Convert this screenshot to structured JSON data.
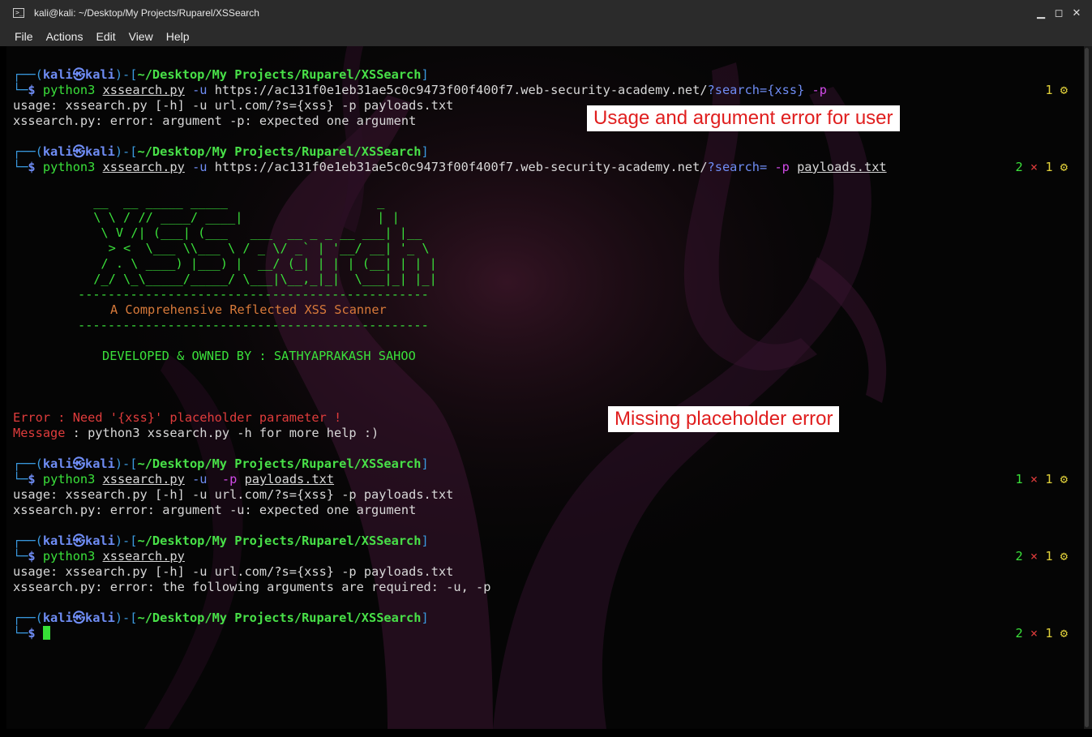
{
  "window": {
    "title": "kali@kali: ~/Desktop/My Projects/Ruparel/XSSearch",
    "controls": [
      "▁",
      "◻",
      "✕"
    ]
  },
  "menu": [
    "File",
    "Actions",
    "Edit",
    "View",
    "Help"
  ],
  "prompt": {
    "user": "kali",
    "at_symbol": "㉿",
    "host": "kali",
    "path": "~/Desktop/My Projects/Ruparel/XSSearch",
    "dollar": "$"
  },
  "cmd1": {
    "python": "python3",
    "script": "xssearch.py",
    "u_flag": "-u",
    "url": "https://ac131f0e1eb31ae5c0c9473f00f400f7.web-security-academy.net/",
    "query": "?search=",
    "placeholder": "{xss}",
    "p_flag": "-p",
    "status": "1 ⚙",
    "out1": "usage: xssearch.py [-h] -u url.com/?s={xss} -p payloads.txt",
    "out2": "xssearch.py: error: argument -p: expected one argument"
  },
  "cmd2": {
    "python": "python3",
    "script": "xssearch.py",
    "u_flag": "-u",
    "url": "https://ac131f0e1eb31ae5c0c9473f00f400f7.web-security-academy.net/",
    "query": "?search=",
    "p_flag": "-p",
    "payloads": "payloads.txt",
    "status_a": "2",
    "status_x": "×",
    "status_b": "1 ⚙"
  },
  "banner": {
    "art1": " __  __ _____ _____                    _     ",
    "art2": " \\ \\ / // ____/ ____|                  | |    ",
    "art3": "  \\ V /| (___| (___   ___  __ _ _ __ ___| |__  ",
    "art4": "   > <  \\___ \\\\___ \\ / _ \\/ _` | '__/ __| '_ \\ ",
    "art5": "  / . \\ ____) |___) |  __/ (_| | | | (__| | | |",
    "art6": " /_/ \\_\\_____/_____/ \\___|\\__,_|_|  \\___|_| |_|",
    "rule": "-----------------------------------------------",
    "tagline": "A Comprehensive Reflected XSS Scanner",
    "developer": "DEVELOPED & OWNED BY : SATHYAPRAKASH SAHOO"
  },
  "errors": {
    "error_label": "Error",
    "error_text": " : Need '{xss}' placeholder parameter !",
    "message_label": "Message",
    "message_text": " : python3 xssearch.py -h for more help :)"
  },
  "cmd3": {
    "python": "python3",
    "script": "xssearch.py",
    "u_flag": "-u",
    "p_flag": "-p",
    "payloads": "payloads.txt",
    "status_a": "1",
    "status_x": "×",
    "status_b": "1 ⚙",
    "out1": "usage: xssearch.py [-h] -u url.com/?s={xss} -p payloads.txt",
    "out2": "xssearch.py: error: argument -u: expected one argument"
  },
  "cmd4": {
    "python": "python3",
    "script": "xssearch.py",
    "status_a": "2",
    "status_x": "×",
    "status_b": "1 ⚙",
    "out1": "usage: xssearch.py [-h] -u url.com/?s={xss} -p payloads.txt",
    "out2": "xssearch.py: error: the following arguments are required: -u, -p"
  },
  "cmd5": {
    "status_a": "2",
    "status_x": "×",
    "status_b": "1 ⚙"
  },
  "annotations": {
    "usage": "Usage and argument error  for user",
    "missing": "Missing placeholder error"
  },
  "colors": {
    "terminal_bg": "#050505",
    "prompt_green": "#3ae03a",
    "prompt_blue": "#6f8df5",
    "error_red": "#e03c3c",
    "tagline_orange": "#d87a3a",
    "flag_magenta": "#d24be8",
    "annotation_red": "#e01e1e"
  }
}
